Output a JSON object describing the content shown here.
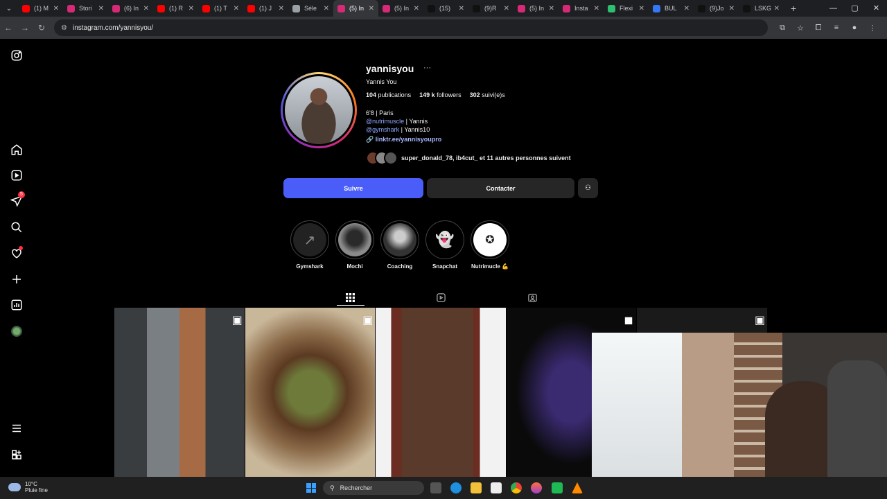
{
  "browser": {
    "tabs": [
      {
        "title": "(1) M",
        "color": "#ff0000"
      },
      {
        "title": "Stori",
        "color": "#d62976"
      },
      {
        "title": "(6) In",
        "color": "#d62976"
      },
      {
        "title": "(1) R",
        "color": "#ff0000"
      },
      {
        "title": "(1) T",
        "color": "#ff0000"
      },
      {
        "title": "(1) J",
        "color": "#ff0000"
      },
      {
        "title": "Séle",
        "color": "#9aa0a6"
      },
      {
        "title": "(5) In",
        "color": "#d62976"
      },
      {
        "title": "(5) In",
        "color": "#d62976"
      },
      {
        "title": "(15)",
        "color": "#111111"
      },
      {
        "title": "(9)R",
        "color": "#111111"
      },
      {
        "title": "(5) In",
        "color": "#d62976"
      },
      {
        "title": "Insta",
        "color": "#d62976"
      },
      {
        "title": "Flexi",
        "color": "#2fbf71"
      },
      {
        "title": "BUL",
        "color": "#3478f6"
      },
      {
        "title": "(9)Jo",
        "color": "#111111"
      },
      {
        "title": "LSKG",
        "color": "#111111"
      }
    ],
    "active_tab_index": 7,
    "new_tab": "+",
    "url": "instagram.com/yannisyou/"
  },
  "profile": {
    "username": "yannisyou",
    "more": "···",
    "full_name": "Yannis You",
    "stats": {
      "posts_count": "104",
      "posts_label": "publications",
      "followers_count": "149 k",
      "followers_label": "followers",
      "following_count": "302",
      "following_label": "suivi(e)s"
    },
    "bio_line1": "6'8 | Paris",
    "bio_line2_mention": "@nutrimuscle",
    "bio_line2_rest": " | Yannis",
    "bio_line3_mention": "@gymshark",
    "bio_line3_rest": " | Yannis10",
    "link": "linktr.ee/yannisyoupro",
    "followed_by": "super_donald_78, ib4cut_ et 11 autres personnes suivent"
  },
  "actions": {
    "follow": "Suivre",
    "contact": "Contacter"
  },
  "highlights": [
    {
      "label": "Gymshark"
    },
    {
      "label": "Mochi"
    },
    {
      "label": "Coaching"
    },
    {
      "label": "Snapchat"
    },
    {
      "label": "Nutrimucle 💪"
    }
  ],
  "sidebar": {
    "notifications_badge": "5"
  },
  "taskbar": {
    "temp": "10°C",
    "condition": "Pluie fine",
    "search_placeholder": "Rechercher"
  }
}
